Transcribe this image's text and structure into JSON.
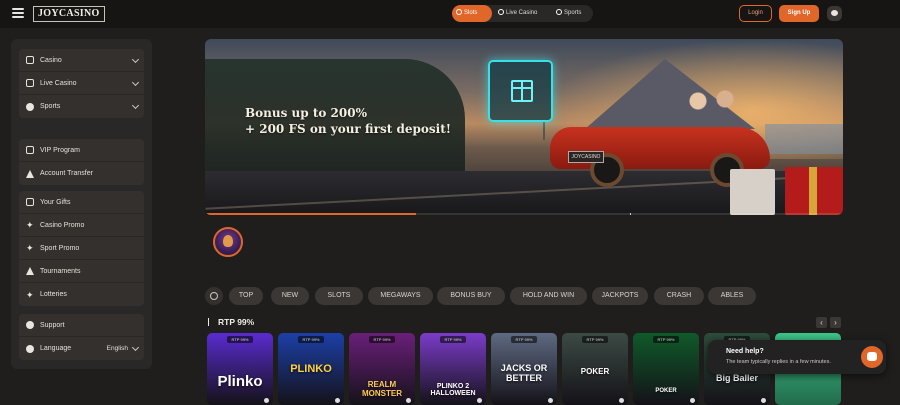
{
  "header": {
    "logo": "JOYCASINO",
    "tabs": [
      {
        "label": "Slots",
        "active": true
      },
      {
        "label": "Live Casino",
        "active": false
      },
      {
        "label": "Sports",
        "active": false
      }
    ],
    "login_label": "Login",
    "signup_label": "Sign Up"
  },
  "sidebar": {
    "group1": [
      {
        "label": "Casino",
        "icon": "casino-icon"
      },
      {
        "label": "Live Casino",
        "icon": "live-casino-icon"
      },
      {
        "label": "Sports",
        "icon": "sports-ball-icon"
      }
    ],
    "group2": [
      {
        "label": "VIP Program",
        "icon": "vip-icon"
      },
      {
        "label": "Account Transfer",
        "icon": "transfer-icon"
      }
    ],
    "group3": [
      {
        "label": "Your Gifts",
        "icon": "gift-icon"
      },
      {
        "label": "Casino Promo",
        "icon": "casino-promo-icon"
      },
      {
        "label": "Sport Promo",
        "icon": "sport-promo-icon"
      },
      {
        "label": "Tournaments",
        "icon": "trophy-icon"
      },
      {
        "label": "Lotteries",
        "icon": "lottery-icon"
      }
    ],
    "group4": [
      {
        "label": "Support",
        "icon": "support-icon"
      },
      {
        "label": "Language",
        "icon": "globe-icon",
        "value": "English"
      }
    ]
  },
  "banner": {
    "line1": "Bonus up to 200%",
    "line2": "+ 200 FS on your first deposit!",
    "plate": "JOYCASINO",
    "progress": 0.33
  },
  "categories": [
    "TOP",
    "NEW",
    "SLOTS",
    "MEGAWAYS",
    "BONUS BUY",
    "HOLD AND WIN",
    "JACKPOTS",
    "CRASH",
    "ABLES"
  ],
  "games_section": {
    "title": "RTP 99%",
    "games": [
      {
        "title": "Plinko",
        "rtp": "RTP 99%",
        "color": "#5a2bd0"
      },
      {
        "title": "PLINKO",
        "rtp": "RTP 99%",
        "color": "#1c3fa8"
      },
      {
        "title": "REALM MONSTER",
        "rtp": "RTP 99%",
        "color": "#6a1f7a"
      },
      {
        "title": "PLINKO 2 HALLOWEEN",
        "rtp": "RTP 99%",
        "color": "#7b3cc9"
      },
      {
        "title": "JACKS OR BETTER",
        "rtp": "RTP 99%",
        "color": "#5e6a82"
      },
      {
        "title": "POKER",
        "rtp": "RTP 99%",
        "color": "#3c4a44"
      },
      {
        "title": "POKER",
        "rtp": "RTP 99%",
        "color": "#0f5a2a"
      },
      {
        "title": "Big Baller",
        "rtp": "RTP 99%",
        "color": "#2e4c3c"
      }
    ]
  },
  "help": {
    "title": "Need help?",
    "subtitle": "The team typically replies in a few minutes."
  }
}
